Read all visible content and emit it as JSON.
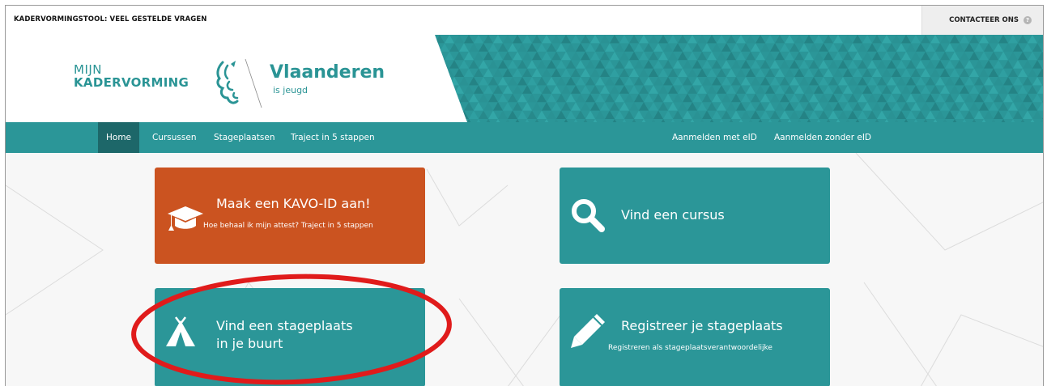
{
  "topbar": {
    "title": "KADERVORMINGSTOOL: VEEL GESTELDE VRAGEN",
    "contact_label": "CONTACTEER ONS",
    "help_icon": "?"
  },
  "brand": {
    "line1": "MIJN",
    "line2": "KADERVORMING",
    "vl_title": "Vlaanderen",
    "vl_sub": "is jeugd"
  },
  "nav": {
    "items": [
      "Home",
      "Cursussen",
      "Stageplaatsen",
      "Traject in 5 stappen"
    ],
    "right_items": [
      "Aanmelden met eID",
      "Aanmelden zonder eID"
    ]
  },
  "cards": [
    {
      "title": "Maak een KAVO-ID aan!",
      "subtitle": "Hoe behaal ik mijn attest? Traject in 5 stappen",
      "icon": "graduation-cap-icon"
    },
    {
      "title": "Vind een cursus",
      "icon": "search-icon"
    },
    {
      "title_line1": "Vind een stageplaats",
      "title_line2": "in je buurt",
      "icon": "tent-icon"
    },
    {
      "title": "Registreer je stageplaats",
      "subtitle": "Registreren als stageplaatsverantwoordelijke",
      "icon": "pencil-icon"
    }
  ],
  "colors": {
    "teal": "#2b9698",
    "teal_dark": "#1d6769",
    "orange": "#cb5320",
    "highlight_red": "#e01b1b"
  }
}
